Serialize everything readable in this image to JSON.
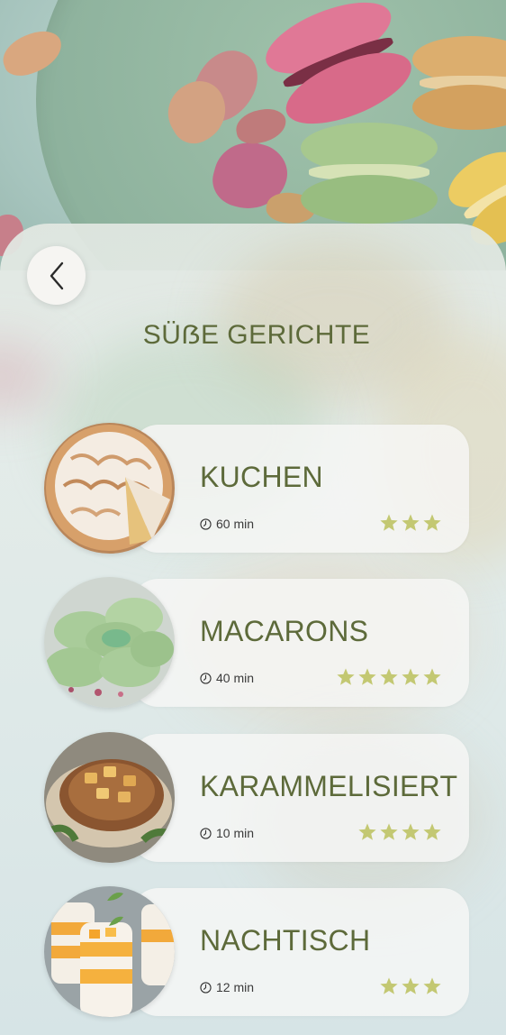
{
  "page": {
    "title": "SÜẞE GERICHTE"
  },
  "back_button": {
    "icon": "chevron-left-icon"
  },
  "colors": {
    "accent": "#5d6a3a",
    "star": "#c3c872",
    "card": "#f6f7f5"
  },
  "recipes": [
    {
      "name": "KUCHEN",
      "time": "60 min",
      "rating": 3,
      "image": "meringue-tart"
    },
    {
      "name": "MACARONS",
      "time": "40 min",
      "rating": 5,
      "image": "green-macarons"
    },
    {
      "name": "KARAMMELISIERT",
      "time": "10 min",
      "rating": 4,
      "image": "caramelized-pork"
    },
    {
      "name": "NACHTISCH",
      "time": "12 min",
      "rating": 3,
      "image": "mango-dessert-glasses"
    }
  ]
}
